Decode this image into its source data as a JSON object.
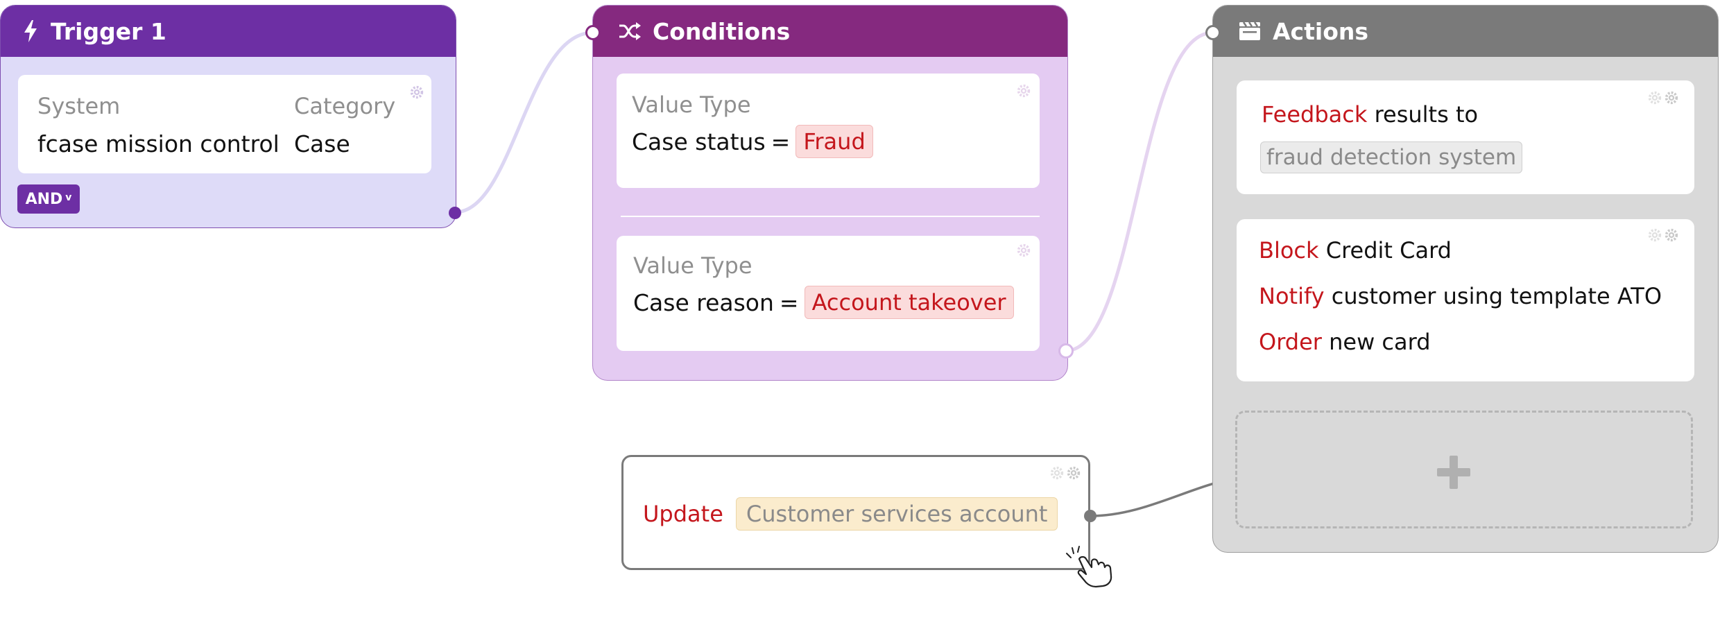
{
  "trigger": {
    "title": "Trigger 1",
    "system_label": "System",
    "system_value": "fcase mission control",
    "category_label": "Category",
    "category_value": "Case",
    "and_label": "AND",
    "and_chevron": "v"
  },
  "conditions": {
    "title": "Conditions",
    "items": [
      {
        "label": "Value Type",
        "field": "Case status",
        "operator": "=",
        "value": "Fraud"
      },
      {
        "label": "Value Type",
        "field": "Case reason",
        "operator": "=",
        "value": "Account takeover"
      }
    ]
  },
  "actions": {
    "title": "Actions",
    "feedback": {
      "verb": "Feedback",
      "text": "results to",
      "chip": "fraud detection system"
    },
    "group": [
      {
        "verb": "Block",
        "text": "Credit Card"
      },
      {
        "verb": "Notify",
        "text": "customer using template ATO"
      },
      {
        "verb": "Order",
        "text": "new card"
      }
    ],
    "add_icon": "plus-icon"
  },
  "update": {
    "verb": "Update",
    "chip": "Customer services account"
  },
  "colors": {
    "trigger_header": "#6d2fa4",
    "conditions_header": "#85297f",
    "actions_header": "#7a7a7a",
    "verb_red": "#c4161c"
  }
}
